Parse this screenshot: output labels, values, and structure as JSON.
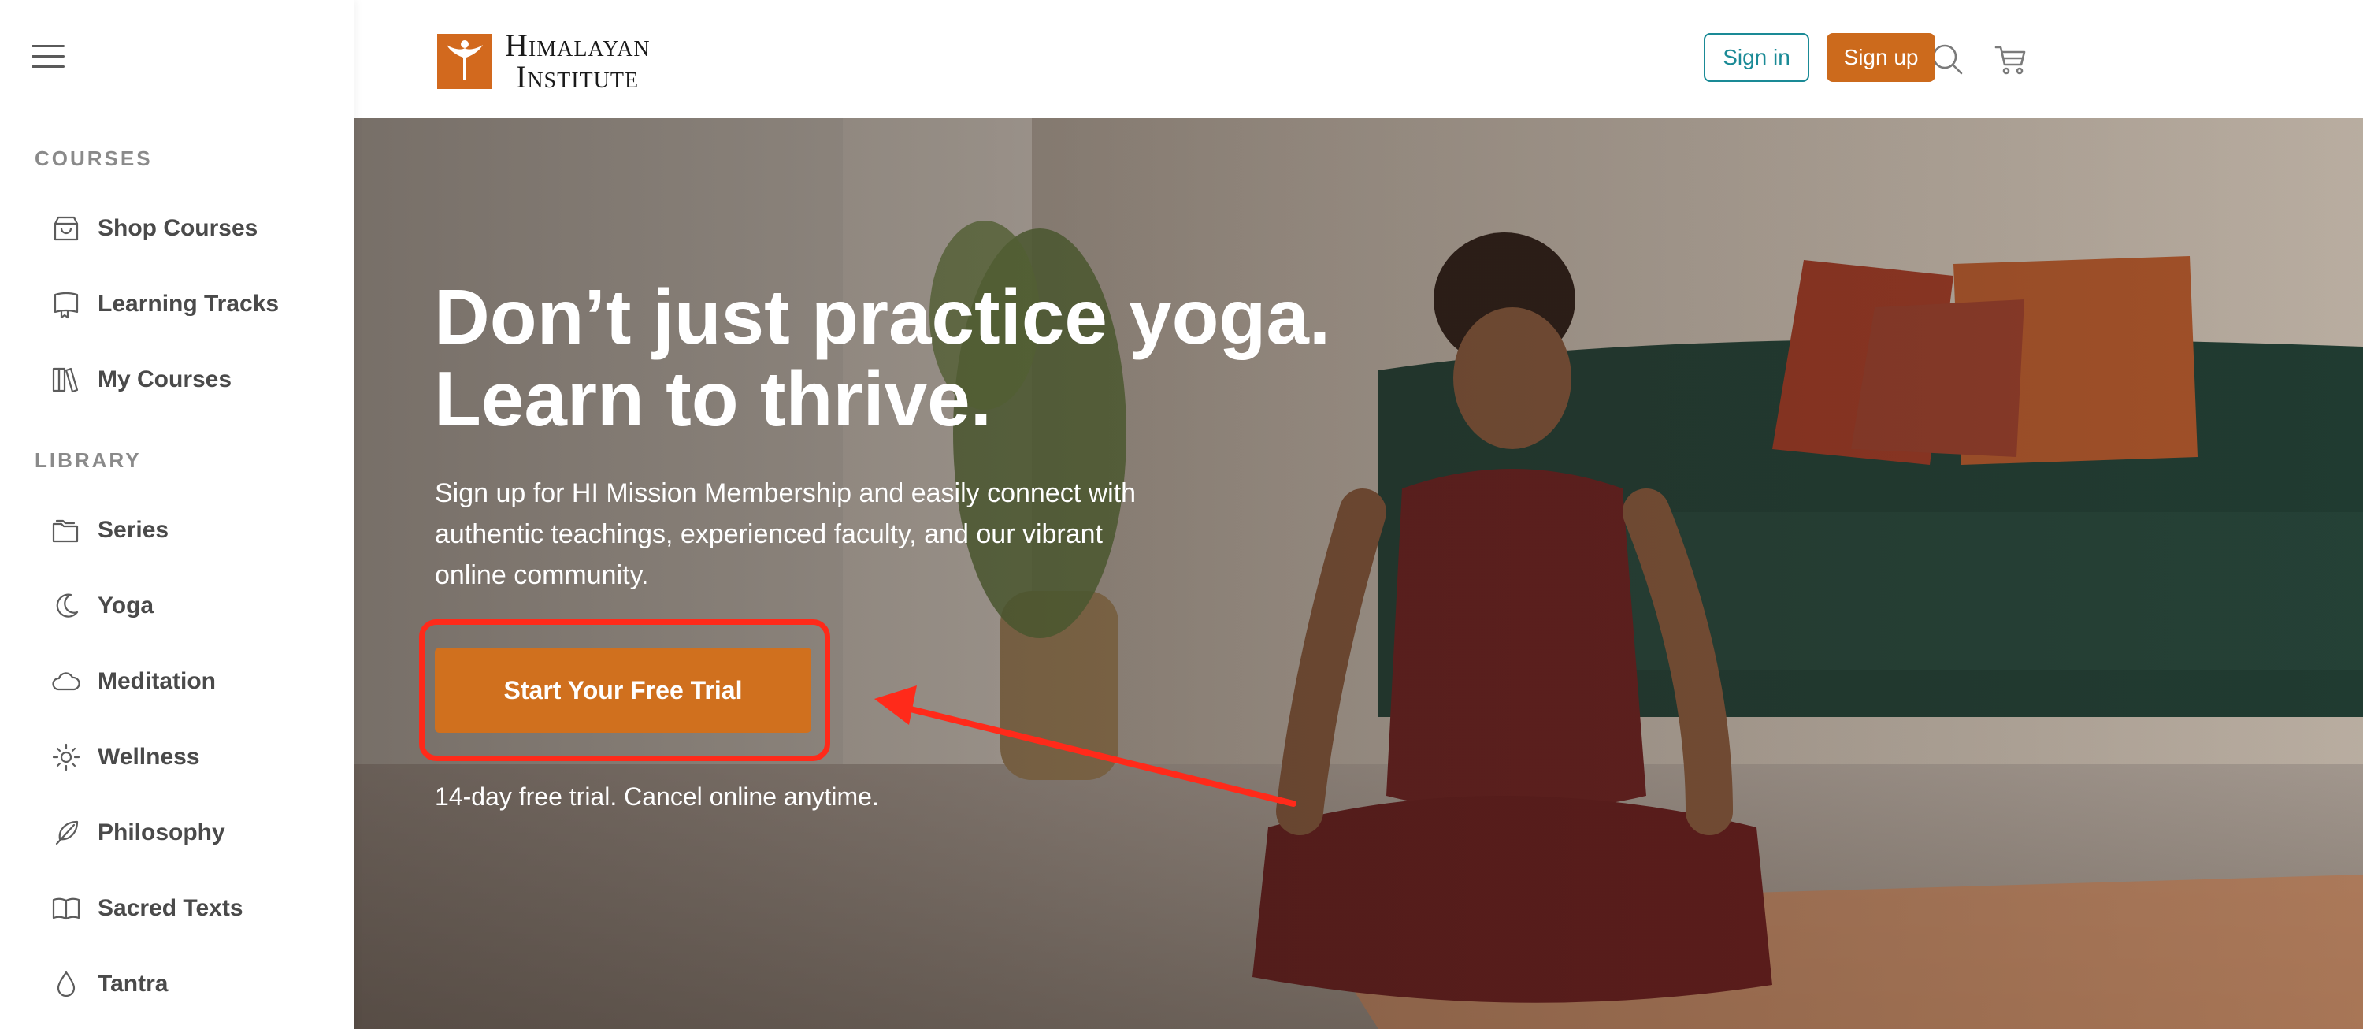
{
  "sidebar": {
    "sections": [
      {
        "title": "COURSES",
        "items": [
          {
            "label": "Shop Courses",
            "icon": "shop-icon"
          },
          {
            "label": "Learning Tracks",
            "icon": "learning-tracks-icon"
          },
          {
            "label": "My Courses",
            "icon": "books-icon"
          }
        ]
      },
      {
        "title": "LIBRARY",
        "items": [
          {
            "label": "Series",
            "icon": "folders-icon"
          },
          {
            "label": "Yoga",
            "icon": "moon-icon"
          },
          {
            "label": "Meditation",
            "icon": "cloud-icon"
          },
          {
            "label": "Wellness",
            "icon": "sun-icon"
          },
          {
            "label": "Philosophy",
            "icon": "feather-icon"
          },
          {
            "label": "Sacred Texts",
            "icon": "open-book-icon"
          },
          {
            "label": "Tantra",
            "icon": "drop-icon"
          }
        ]
      }
    ]
  },
  "header": {
    "logo_line1": "Himalayan",
    "logo_line2": "Institute",
    "search_icon": "search-icon",
    "cart_icon": "cart-icon",
    "sign_in": "Sign in",
    "sign_up": "Sign up"
  },
  "hero": {
    "title_line1": "Don’t just practice yoga.",
    "title_line2": "Learn to thrive.",
    "subtitle": "Sign up for HI Mission Membership and easily connect with authentic teachings, experienced faculty, and our vibrant online community.",
    "cta": "Start Your Free Trial",
    "note": "14-day free trial. Cancel online anytime."
  },
  "colors": {
    "brand_orange": "#d0701e",
    "teal": "#1a8a96",
    "annotation_red": "#ff2a1a"
  }
}
